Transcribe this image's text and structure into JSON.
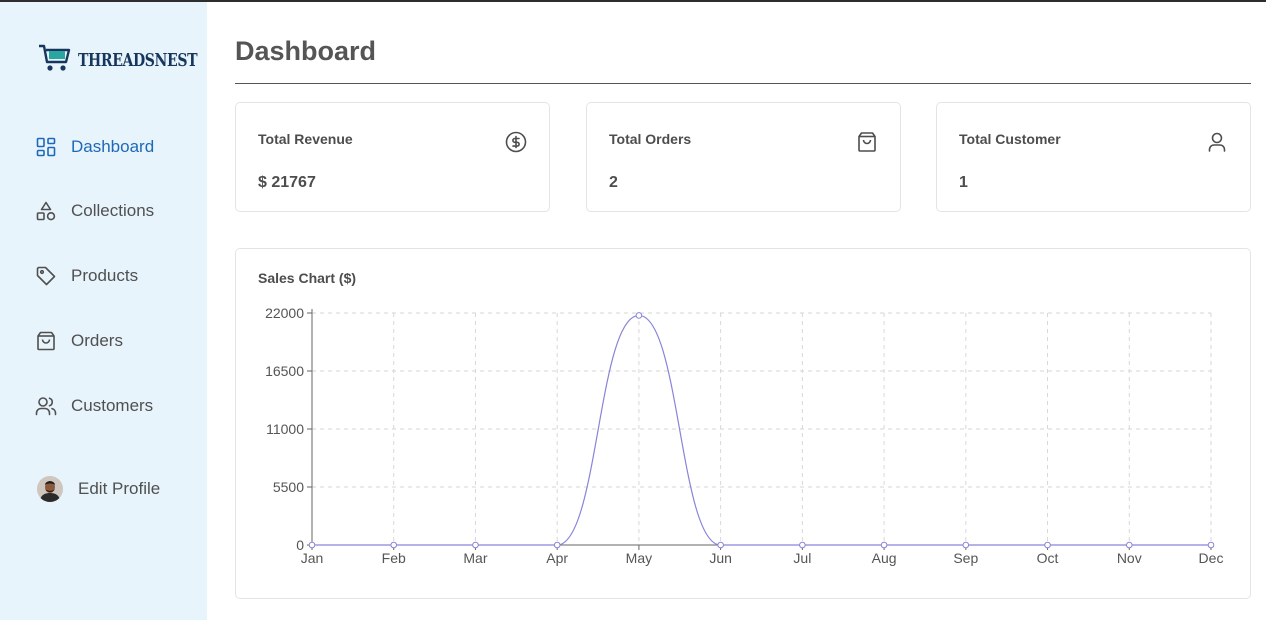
{
  "brand": {
    "name": "THREADSNEST"
  },
  "sidebar": {
    "items": [
      {
        "label": "Dashboard",
        "icon": "dashboard-icon",
        "active": true
      },
      {
        "label": "Collections",
        "icon": "shapes-icon",
        "active": false
      },
      {
        "label": "Products",
        "icon": "tag-icon",
        "active": false
      },
      {
        "label": "Orders",
        "icon": "shopping-bag-icon",
        "active": false
      },
      {
        "label": "Customers",
        "icon": "users-icon",
        "active": false
      }
    ],
    "profile_label": "Edit Profile"
  },
  "page": {
    "title": "Dashboard"
  },
  "cards": [
    {
      "label": "Total Revenue",
      "value": "$ 21767",
      "icon": "circle-dollar-icon"
    },
    {
      "label": "Total Orders",
      "value": "2",
      "icon": "shopping-bag-icon"
    },
    {
      "label": "Total Customer",
      "value": "1",
      "icon": "user-icon"
    }
  ],
  "chart": {
    "title": "Sales Chart ($)"
  },
  "chart_data": {
    "type": "line",
    "title": "Sales Chart ($)",
    "categories": [
      "Jan",
      "Feb",
      "Mar",
      "Apr",
      "May",
      "Jun",
      "Jul",
      "Aug",
      "Sep",
      "Oct",
      "Nov",
      "Dec"
    ],
    "values": [
      0,
      0,
      0,
      0,
      21767,
      0,
      0,
      0,
      0,
      0,
      0,
      0
    ],
    "yticks": [
      0,
      5500,
      11000,
      16500,
      22000
    ],
    "ylim": [
      0,
      22000
    ],
    "grid": true,
    "line_color": "#8884d8"
  },
  "colors": {
    "accent": "#1e68b8",
    "sidebar_bg": "#e8f4fc"
  }
}
